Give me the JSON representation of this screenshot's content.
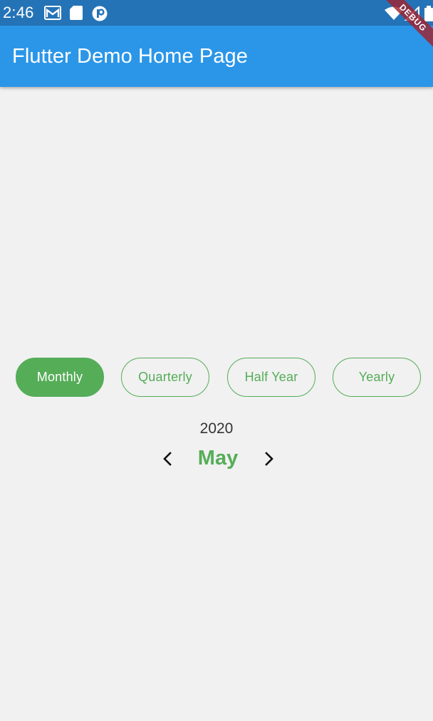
{
  "status_bar": {
    "time": "2:46",
    "icons": [
      "gmail-icon",
      "sd-card-icon",
      "sync-circle-icon",
      "wifi-icon",
      "signal-icon",
      "battery-icon"
    ]
  },
  "app_bar": {
    "title": "Flutter Demo Home Page"
  },
  "debug_banner": {
    "label": "DEBUG"
  },
  "period_selector": {
    "options": [
      "Monthly",
      "Quarterly",
      "Half Year",
      "Yearly"
    ],
    "selected": "Monthly"
  },
  "date_display": {
    "year": "2020",
    "month": "May",
    "prev_icon": "chevron-left-icon",
    "next_icon": "chevron-right-icon"
  },
  "colors": {
    "status_bar": "#2573b7",
    "app_bar": "#2b96e8",
    "accent_green": "#55ad58",
    "background": "#f1f1f1",
    "debug_banner": "#a02230"
  }
}
